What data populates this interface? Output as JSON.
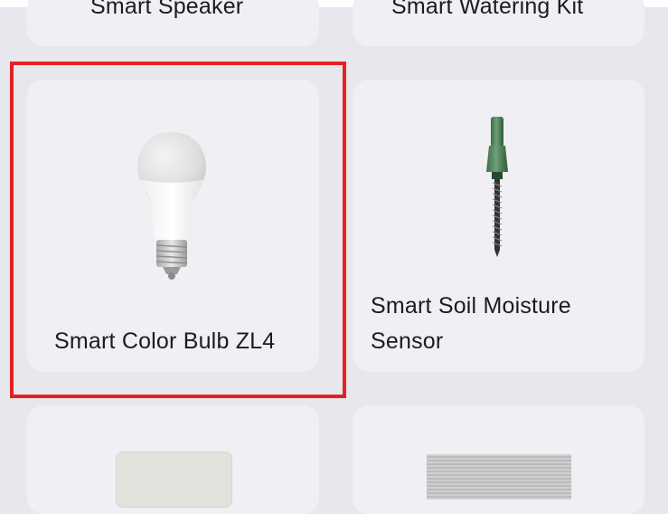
{
  "devices": [
    {
      "label": "Smart Speaker"
    },
    {
      "label": "Smart Watering Kit"
    },
    {
      "label": "Smart Color Bulb ZL4",
      "selected": true
    },
    {
      "label_line1": "Smart Soil Moisture",
      "label_line2": "Sensor"
    },
    {
      "label": ""
    },
    {
      "label": ""
    }
  ],
  "colors": {
    "background": "#e8e7ed",
    "card": "#f0eff4",
    "selection_border": "#e32222"
  }
}
